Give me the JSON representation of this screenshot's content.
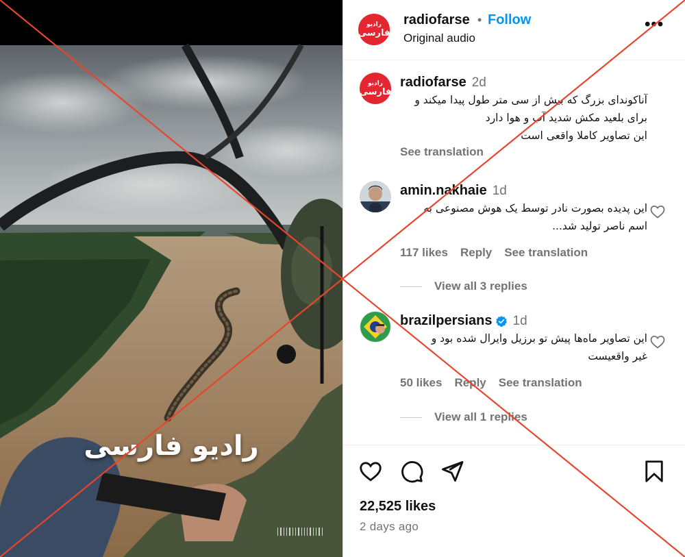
{
  "video": {
    "caption": "رادیو فارسی"
  },
  "header": {
    "username": "radiofarse",
    "separator": "•",
    "follow_label": "Follow",
    "audio_label": "Original audio",
    "more_label": "•••",
    "avatar_mark": "رادیو",
    "avatar_word": "فارسی"
  },
  "caption_post": {
    "username": "radiofarse",
    "time": "2d",
    "text": "آناکوندای بزرگ که بیش از سی متر طول پیدا میکند و\nبرای بلعید مکش شدید آب و هوا دارد\nاین تصاویر کاملا واقعی است",
    "see_translation": "See translation"
  },
  "comments": [
    {
      "username": "amin.nakhaie",
      "time": "1d",
      "text": "این پدیده بصورت نادر توسط یک هوش مصنوعی به\nاسم ناصر تولید شد...",
      "likes": "117 likes",
      "reply": "Reply",
      "see_translation": "See translation",
      "view_replies": "View all 3 replies"
    },
    {
      "username": "brazilpersians",
      "time": "1d",
      "verified": true,
      "text": "این تصاویر ماه‌ها پیش تو برزیل وایرال شده بود و\nغیر واقعیست",
      "likes": "50 likes",
      "reply": "Reply",
      "see_translation": "See translation",
      "view_replies": "View all 1 replies"
    }
  ],
  "footer": {
    "likes": "22,525 likes",
    "time_ago": "2 days ago"
  },
  "colors": {
    "accent_blue": "#0095f6",
    "brand_red": "#e3262f",
    "overlay_red": "#e8452c",
    "muted_text": "#737373"
  },
  "icons": [
    "heart-icon",
    "comment-icon",
    "share-icon",
    "bookmark-icon",
    "more-icon",
    "verified-icon"
  ]
}
